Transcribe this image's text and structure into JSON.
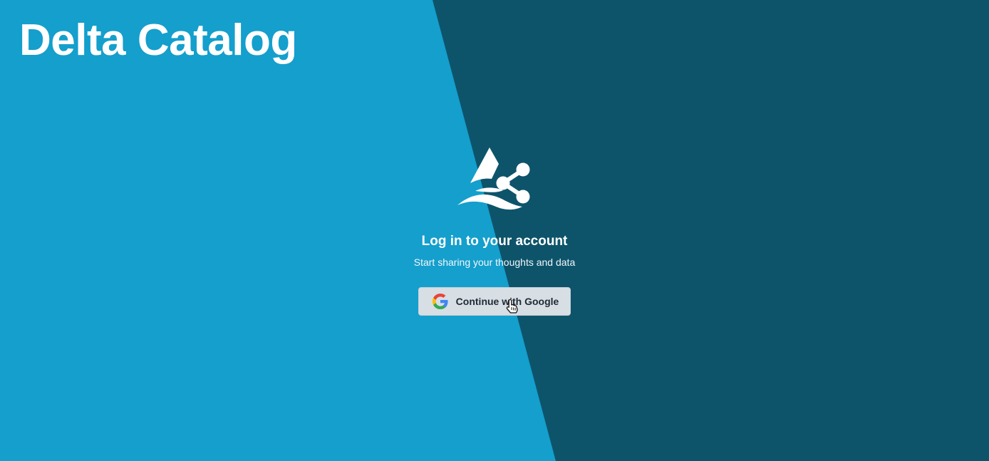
{
  "app": {
    "title": "Delta Catalog"
  },
  "login": {
    "heading": "Log in to your account",
    "subheading": "Start sharing your thoughts and data",
    "google_button_label": "Continue with Google"
  },
  "colors": {
    "light_blue": "#149fcd",
    "dark_teal": "#0d546b",
    "button_bg": "#d7dee4",
    "text_white": "#ffffff"
  },
  "icons": {
    "logo": "delta-share-logo-icon",
    "google": "google-g-icon",
    "cursor": "hand-pointer-icon"
  }
}
